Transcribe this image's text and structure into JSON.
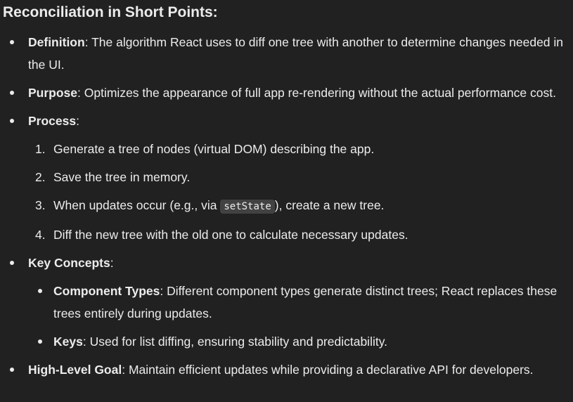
{
  "heading": "Reconciliation in Short Points:",
  "items": [
    {
      "term": "Definition",
      "text": ": The algorithm React uses to diff one tree with another to determine changes needed in the UI."
    },
    {
      "term": "Purpose",
      "text": ": Optimizes the appearance of full app re-rendering without the actual performance cost."
    },
    {
      "term": "Process",
      "text": ":",
      "steps": [
        {
          "num": "1.",
          "text": "Generate a tree of nodes (virtual DOM) describing the app."
        },
        {
          "num": "2.",
          "text": "Save the tree in memory."
        },
        {
          "num": "3.",
          "text_before": "When updates occur (e.g., via ",
          "code": "setState",
          "text_after": "), create a new tree."
        },
        {
          "num": "4.",
          "text": "Diff the new tree with the old one to calculate necessary updates."
        }
      ]
    },
    {
      "term": "Key Concepts",
      "text": ":",
      "concepts": [
        {
          "term": "Component Types",
          "text": ": Different component types generate distinct trees; React replaces these trees entirely during updates."
        },
        {
          "term": "Keys",
          "text": ": Used for list diffing, ensuring stability and predictability."
        }
      ]
    },
    {
      "term": "High-Level Goal",
      "text": ": Maintain efficient updates while providing a declarative API for developers."
    }
  ]
}
